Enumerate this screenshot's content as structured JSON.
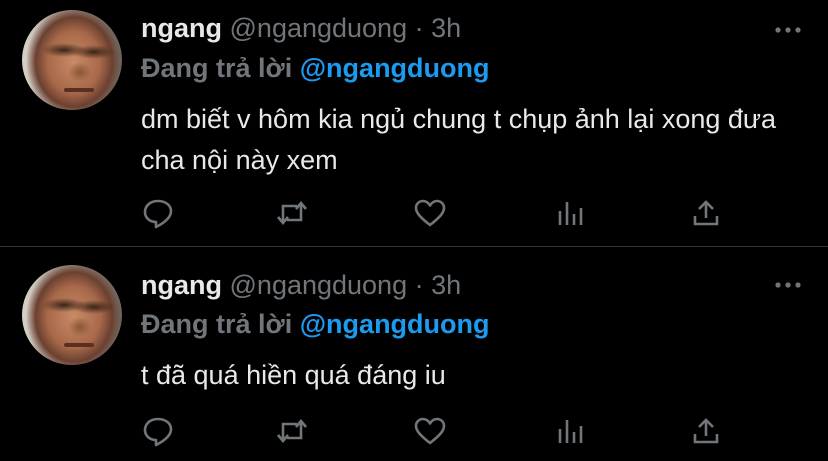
{
  "tweets": [
    {
      "display_name": "ngang",
      "handle": "@ngangduong",
      "separator": "·",
      "time": "3h",
      "replying_prefix": "Đang trả lời",
      "replying_to": "@ngangduong",
      "text": "dm biết v hôm kia ngủ chung t chụp ảnh lại xong đưa cha nội này xem"
    },
    {
      "display_name": "ngang",
      "handle": "@ngangduong",
      "separator": "·",
      "time": "3h",
      "replying_prefix": "Đang trả lời",
      "replying_to": "@ngangduong",
      "text": "t đã quá hiền quá đáng iu"
    }
  ],
  "icons": {
    "reply": "reply-icon",
    "retweet": "retweet-icon",
    "like": "heart-icon",
    "analytics": "analytics-icon",
    "share": "share-icon",
    "more": "more-dots-icon"
  },
  "colors": {
    "background": "#000000",
    "text": "#e7e9ea",
    "secondary": "#71767b",
    "accent": "#1d9bf0",
    "divider": "#2f3336"
  }
}
